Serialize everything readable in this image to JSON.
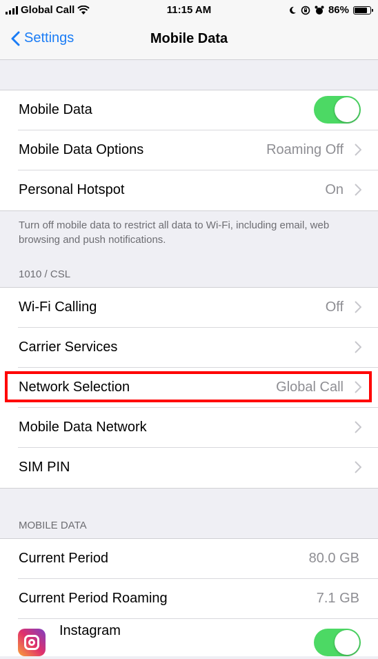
{
  "status": {
    "carrier": "Global Call",
    "time": "11:15 AM",
    "battery": "86%",
    "battery_level": 0.86
  },
  "nav": {
    "back_label": "Settings",
    "title": "Mobile Data"
  },
  "group1": {
    "mobile_data": {
      "label": "Mobile Data",
      "enabled": true
    },
    "mobile_data_options": {
      "label": "Mobile Data Options",
      "value": "Roaming Off"
    },
    "personal_hotspot": {
      "label": "Personal Hotspot",
      "value": "On"
    },
    "footer": "Turn off mobile data to restrict all data to Wi-Fi, including email, web browsing and push notifications."
  },
  "carrier_section": {
    "header": "1010 / CSL",
    "wifi_calling": {
      "label": "Wi-Fi Calling",
      "value": "Off"
    },
    "carrier_services": {
      "label": "Carrier Services"
    },
    "network_selection": {
      "label": "Network Selection",
      "value": "Global Call"
    },
    "mobile_data_network": {
      "label": "Mobile Data Network"
    },
    "sim_pin": {
      "label": "SIM PIN"
    }
  },
  "usage_section": {
    "header": "MOBILE DATA",
    "current_period": {
      "label": "Current Period",
      "value": "80.0 GB"
    },
    "current_period_roaming": {
      "label": "Current Period Roaming",
      "value": "7.1 GB"
    },
    "instagram": {
      "label": "Instagram",
      "enabled": true
    }
  },
  "colors": {
    "accent": "#1a7cf5",
    "toggle_on": "#4cd964",
    "highlight": "#ff0000"
  }
}
